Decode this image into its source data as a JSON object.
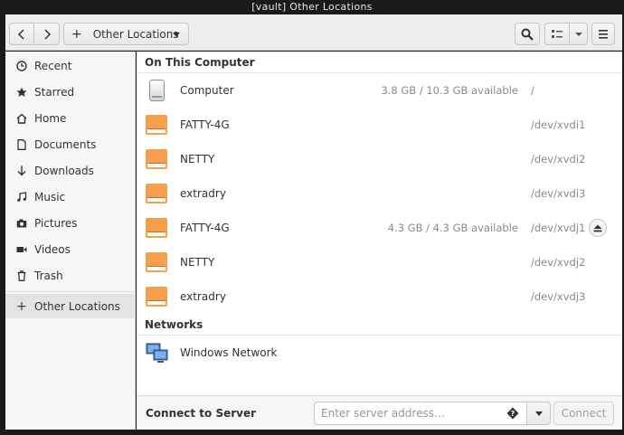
{
  "window": {
    "title": "[vault] Other Locations"
  },
  "header": {
    "back_icon": "chevron-left-icon",
    "forward_icon": "chevron-right-icon",
    "location_label": "Other Locations",
    "search_icon": "search-icon",
    "view_icon": "list-view-icon",
    "menu_icon": "hamburger-menu-icon"
  },
  "sidebar": {
    "items": [
      {
        "label": "Recent",
        "icon": "clock-icon"
      },
      {
        "label": "Starred",
        "icon": "star-icon"
      },
      {
        "label": "Home",
        "icon": "home-icon"
      },
      {
        "label": "Documents",
        "icon": "document-icon"
      },
      {
        "label": "Downloads",
        "icon": "download-arrow-icon"
      },
      {
        "label": "Music",
        "icon": "music-note-icon"
      },
      {
        "label": "Pictures",
        "icon": "camera-icon"
      },
      {
        "label": "Videos",
        "icon": "video-icon"
      },
      {
        "label": "Trash",
        "icon": "trash-icon"
      }
    ],
    "other_locations": {
      "label": "Other Locations",
      "icon": "plus-icon"
    }
  },
  "main": {
    "on_this_computer": "On This Computer",
    "devices": [
      {
        "name": "Computer",
        "space": "3.8 GB / 10.3 GB available",
        "path": "/",
        "icon": "harddisk-icon",
        "eject": false
      },
      {
        "name": "FATTY-4G",
        "space": "",
        "path": "/dev/xvdi1",
        "icon": "drive-icon",
        "eject": false
      },
      {
        "name": "NETTY",
        "space": "",
        "path": "/dev/xvdi2",
        "icon": "drive-icon",
        "eject": false
      },
      {
        "name": "extradry",
        "space": "",
        "path": "/dev/xvdi3",
        "icon": "drive-icon",
        "eject": false
      },
      {
        "name": "FATTY-4G",
        "space": "4.3 GB / 4.3 GB available",
        "path": "/dev/xvdj1",
        "icon": "drive-icon",
        "eject": true
      },
      {
        "name": "NETTY",
        "space": "",
        "path": "/dev/xvdj2",
        "icon": "drive-icon",
        "eject": false
      },
      {
        "name": "extradry",
        "space": "",
        "path": "/dev/xvdj3",
        "icon": "drive-icon",
        "eject": false
      }
    ],
    "networks_title": "Networks",
    "networks": [
      {
        "name": "Windows Network",
        "icon": "network-computers-icon"
      }
    ]
  },
  "connect": {
    "label": "Connect to Server",
    "placeholder": "Enter server address…",
    "button": "Connect"
  },
  "colors": {
    "drive_orange": "#f6a04d",
    "sidebar_bg": "#f6f6f6",
    "header_bg": "#ededed"
  }
}
